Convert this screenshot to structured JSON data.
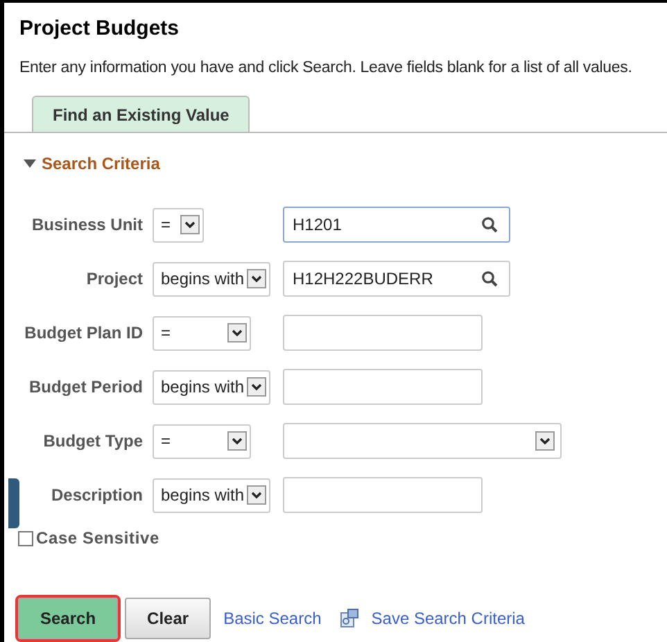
{
  "title": "Project Budgets",
  "instructions": "Enter any information you have and click Search. Leave fields blank for a list of all values.",
  "tabs": [
    {
      "label": "Find an Existing Value",
      "selected": true
    }
  ],
  "section": {
    "title": "Search Criteria",
    "expanded": true
  },
  "criteria": [
    {
      "label": "Business Unit",
      "operator": "=",
      "kind": "prompt",
      "value": "H1201",
      "focused": true
    },
    {
      "label": "Project",
      "operator": "begins with",
      "kind": "prompt",
      "value": "H12H222BUDERR",
      "focused": false
    },
    {
      "label": "Budget Plan ID",
      "operator": "=",
      "kind": "text",
      "focused": false
    },
    {
      "label": "Budget Period",
      "operator": "begins with",
      "kind": "text",
      "focused": false
    },
    {
      "label": "Budget Type",
      "operator": "=",
      "kind": "dropdown",
      "focused": false
    },
    {
      "label": "Description",
      "operator": "begins with",
      "kind": "text",
      "focused": false
    }
  ],
  "case_sensitive": {
    "label": "Case Sensitive",
    "checked": false
  },
  "buttons": [
    {
      "label": "Search",
      "kind": "primary",
      "highlighted": true
    },
    {
      "label": "Clear",
      "kind": "secondary",
      "highlighted": false
    }
  ],
  "links": [
    {
      "label": "Basic Search",
      "kind": "plain"
    },
    {
      "label": "Save Search Criteria",
      "kind": "save"
    }
  ]
}
